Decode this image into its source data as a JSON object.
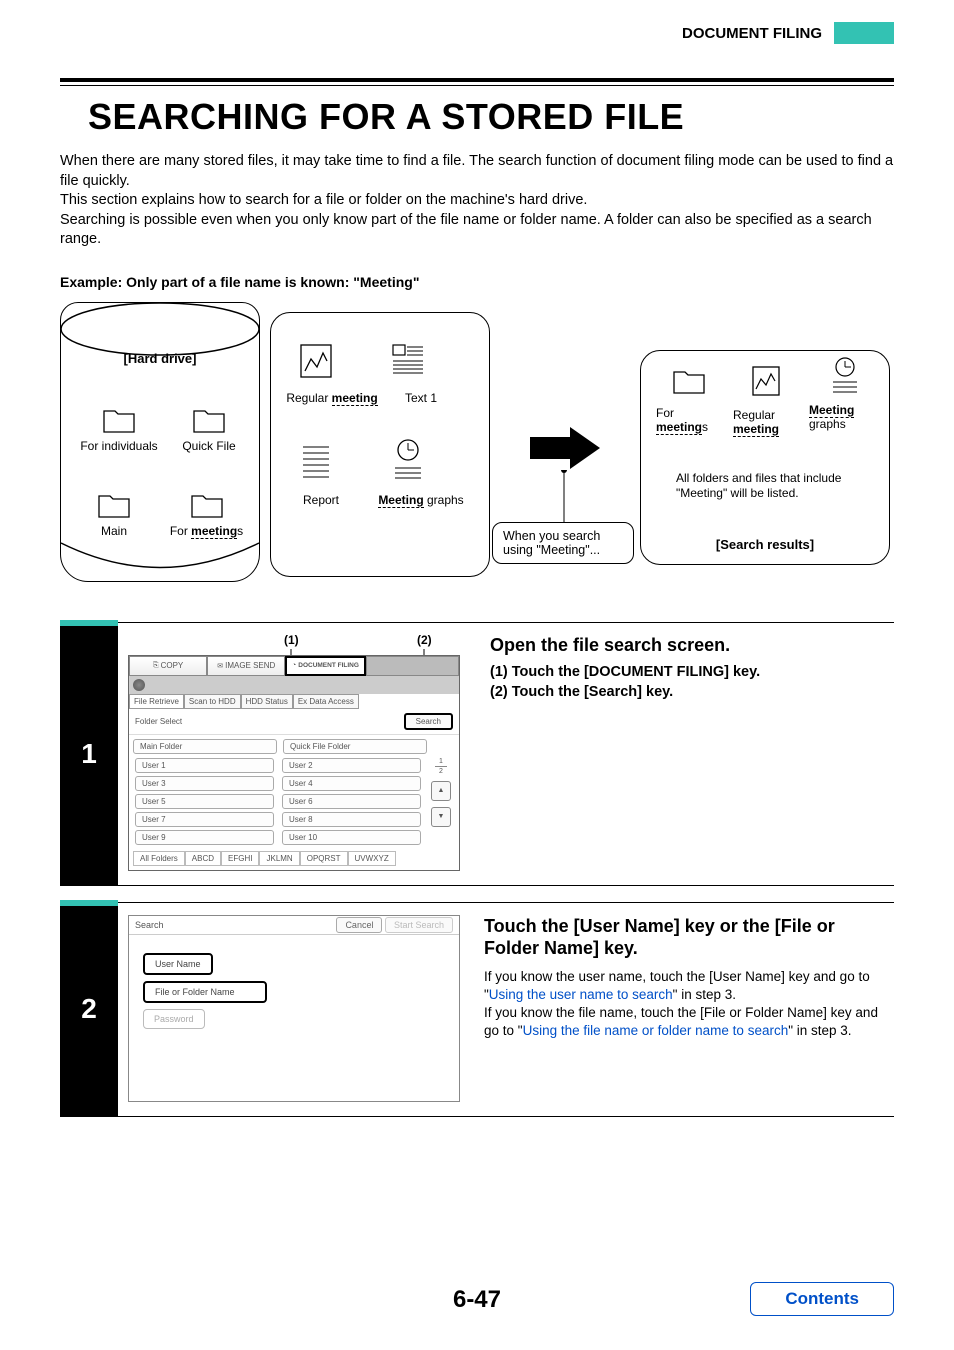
{
  "header": {
    "section": "DOCUMENT FILING"
  },
  "title": "SEARCHING FOR A STORED FILE",
  "intro": {
    "p1": "When there are many stored files, it may take time to find a file. The search function of document filing mode can be used to find a file quickly.",
    "p2": "This section explains how to search for a file or folder on the machine's hard drive.",
    "p3": "Searching is possible even when you only know part of the file name or folder name. A folder can also be specified as a search range."
  },
  "example_line": "Example: Only part of a file name is known: \"Meeting\"",
  "diagram": {
    "hdd_label": "[Hard drive]",
    "folders": {
      "f1": "For individuals",
      "f2": "Quick File",
      "f3": "Main",
      "f4_pre": "For ",
      "f4_bold": "meeting",
      "f4_post": "s"
    },
    "files": {
      "file1_pre": "Regular ",
      "file1_bold": "meeting",
      "file2": "Text 1",
      "file3": "Report",
      "file4_bold": "Meeting",
      "file4_post": " graphs"
    },
    "speech": "When you search using \"Meeting\"...",
    "result_folder_pre": "For",
    "result_folder_bold": "meeting",
    "result_folder_post": "s",
    "result_file1_pre": "Regular",
    "result_file1_bold": "meeting",
    "result_file2_bold": "Meeting",
    "result_file2_post": "graphs",
    "result_note": "All folders and files that include \"Meeting\" will be listed.",
    "results_label": "[Search results]"
  },
  "step1": {
    "num": "1",
    "callout1": "(1)",
    "callout2": "(2)",
    "panel": {
      "tab_copy": "COPY",
      "tab_image_send": "IMAGE SEND",
      "tab_doc_filing": "DOCUMENT FILING",
      "sub_file_retrieve": "File Retrieve",
      "sub_scan_hdd": "Scan to HDD",
      "sub_hdd_status": "HDD Status",
      "sub_ex_data": "Ex Data Access",
      "bar_label": "Folder Select",
      "search_btn": "Search",
      "main_folder": "Main Folder",
      "quick_file_folder": "Quick File Folder",
      "users": [
        "User 1",
        "User 2",
        "User 3",
        "User 4",
        "User 5",
        "User 6",
        "User 7",
        "User 8",
        "User 9",
        "User 10"
      ],
      "page": "1",
      "pages": "2",
      "alpha": [
        "All Folders",
        "ABCD",
        "EFGHI",
        "JKLMN",
        "OPQRST",
        "UVWXYZ"
      ]
    },
    "instr_head": "Open the file search screen.",
    "instr1": "(1)  Touch the [DOCUMENT FILING] key.",
    "instr2": "(2)  Touch the [Search] key."
  },
  "step2": {
    "num": "2",
    "panel": {
      "title": "Search",
      "cancel": "Cancel",
      "start": "Start Search",
      "user_name": "User Name",
      "file_or_folder": "File or Folder Name",
      "password": "Password"
    },
    "instr_head": "Touch the [User Name] key or the [File or Folder Name] key.",
    "p1a": "If you know the user name, touch the [User Name] key and go to \"",
    "link1": "Using the user name to search",
    "p1b": "\" in step 3.",
    "p2a": "If you know the file name, touch the [File or Folder Name] key and go to \"",
    "link2": "Using the file name or folder name to search",
    "p2b": "\" in step 3."
  },
  "page_number": "6-47",
  "contents": "Contents"
}
